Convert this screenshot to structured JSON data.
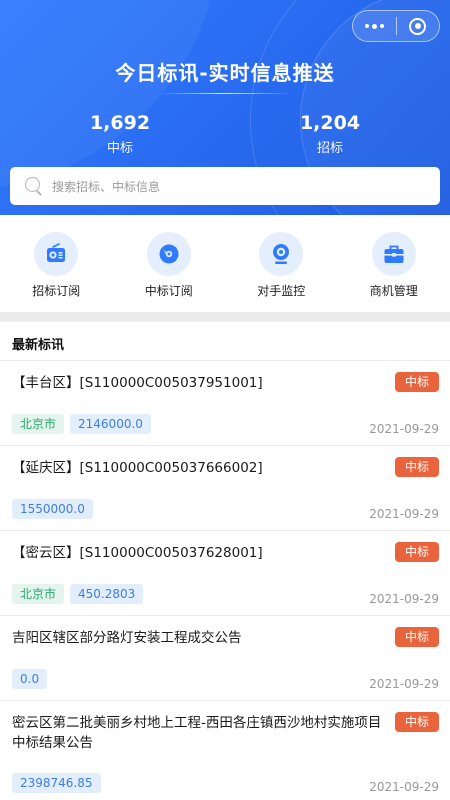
{
  "header": {
    "title": "今日标讯-实时信息推送",
    "stats": [
      {
        "value": "1,692",
        "label": "中标"
      },
      {
        "value": "1,204",
        "label": "招标"
      }
    ]
  },
  "capsule": {
    "more_icon": "more-dots-icon",
    "close_icon": "target-close-icon"
  },
  "search": {
    "placeholder": "搜索招标、中标信息"
  },
  "menu": [
    {
      "label": "招标订阅",
      "icon": "radio-icon"
    },
    {
      "label": "中标订阅",
      "icon": "disc-icon"
    },
    {
      "label": "对手监控",
      "icon": "webcam-icon"
    },
    {
      "label": "商机管理",
      "icon": "briefcase-icon"
    }
  ],
  "section": {
    "title": "最新标讯"
  },
  "items": [
    {
      "title": "【丰台区】[S110000C005037951001]",
      "badge": "中标",
      "tags": [
        "北京市",
        "2146000.0"
      ],
      "date": "2021-09-29"
    },
    {
      "title": "【延庆区】[S110000C005037666002]",
      "badge": "中标",
      "tags": [
        "1550000.0"
      ],
      "date": "2021-09-29"
    },
    {
      "title": "【密云区】[S110000C005037628001]",
      "badge": "中标",
      "tags": [
        "北京市",
        "450.2803"
      ],
      "date": "2021-09-29"
    },
    {
      "title": "吉阳区辖区部分路灯安装工程成交公告",
      "badge": "中标",
      "tags": [
        "0.0"
      ],
      "date": "2021-09-29"
    },
    {
      "title": "密云区第二批美丽乡村地上工程-西田各庄镇西沙地村实施项目中标结果公告",
      "badge": "中标",
      "tags": [
        "2398746.85"
      ],
      "date": "2021-09-29"
    }
  ],
  "colors": {
    "primary": "#2a6df2",
    "badge": "#e9643c",
    "city_tag": "#2aa870",
    "amount_tag": "#3e7ee0"
  }
}
